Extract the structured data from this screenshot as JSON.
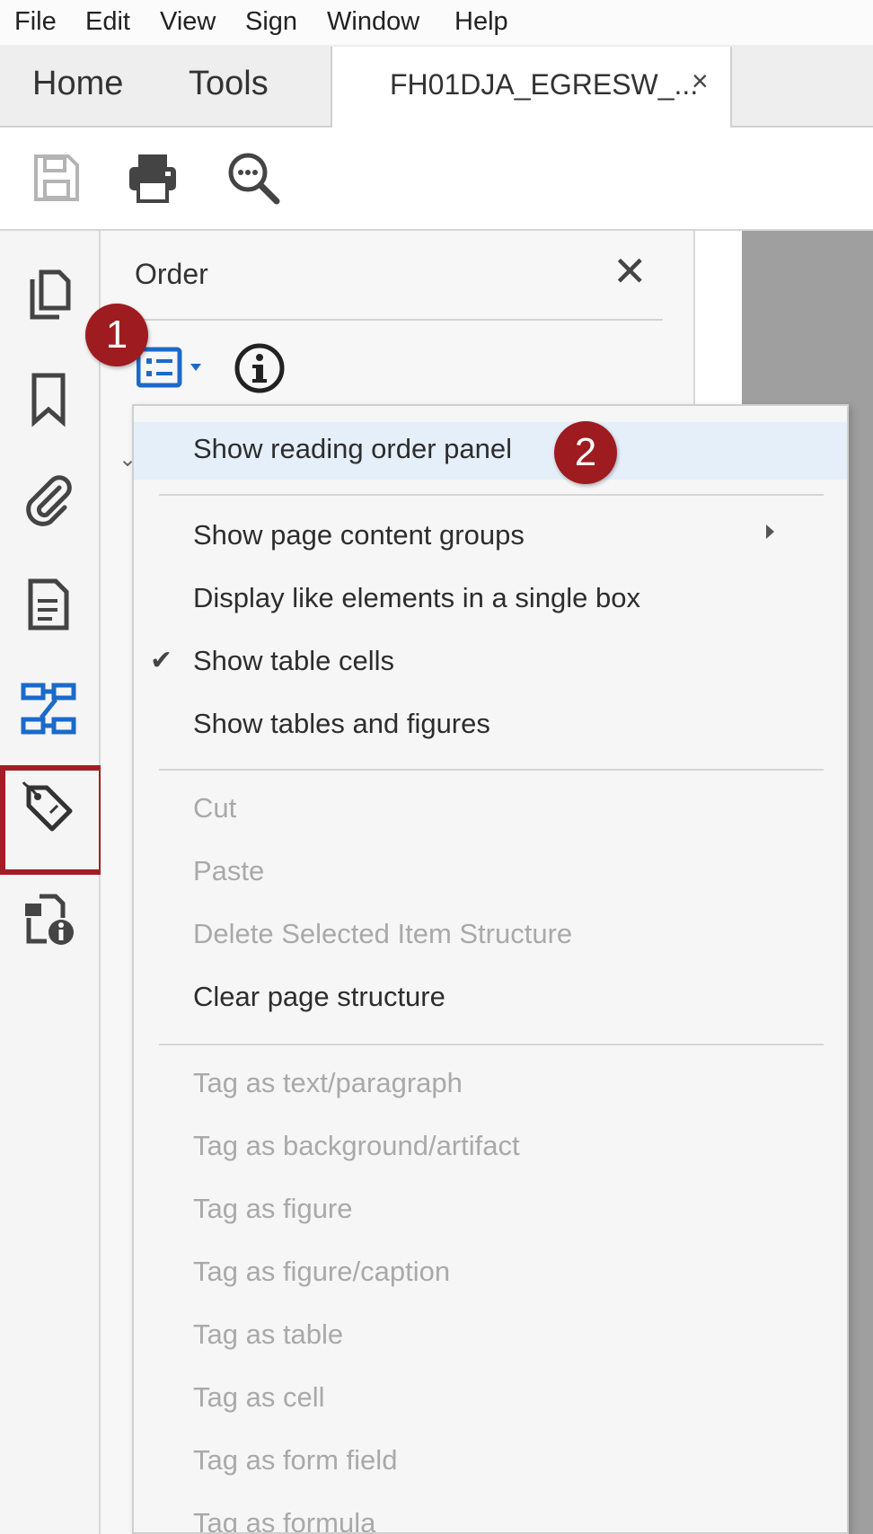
{
  "menubar": [
    "File",
    "Edit",
    "View",
    "Sign",
    "Window",
    "Help"
  ],
  "tabs": {
    "home": "Home",
    "tools": "Tools",
    "document": "FH01DJA_EGRESW_...",
    "close": "×"
  },
  "toolbar": {
    "icons": [
      "save-icon",
      "print-icon",
      "find-icon"
    ]
  },
  "left_rail": {
    "icons": [
      "pages-icon",
      "bookmark-icon",
      "attachment-icon",
      "page-properties-icon",
      "reading-order-icon",
      "tags-icon",
      "content-info-icon"
    ],
    "highlighted": "tags-icon"
  },
  "panel": {
    "title": "Order",
    "close": "✕"
  },
  "badges": {
    "one": "1",
    "two": "2"
  },
  "menu": {
    "items": [
      {
        "label": "Show reading order panel",
        "enabled": true,
        "selected": true
      },
      {
        "label": "Show page content groups",
        "enabled": true,
        "submenu": true
      },
      {
        "label": "Display like elements in a single box",
        "enabled": true
      },
      {
        "label": "Show table cells",
        "enabled": true,
        "checked": true
      },
      {
        "label": "Show tables and figures",
        "enabled": true
      },
      {
        "label": "Cut",
        "enabled": false
      },
      {
        "label": "Paste",
        "enabled": false
      },
      {
        "label": "Delete Selected Item Structure",
        "enabled": false
      },
      {
        "label": "Clear page structure",
        "enabled": true
      },
      {
        "label": "Tag as text/paragraph",
        "enabled": false
      },
      {
        "label": "Tag as background/artifact",
        "enabled": false
      },
      {
        "label": "Tag as figure",
        "enabled": false
      },
      {
        "label": "Tag as figure/caption",
        "enabled": false
      },
      {
        "label": "Tag as table",
        "enabled": false
      },
      {
        "label": "Tag as cell",
        "enabled": false
      },
      {
        "label": "Tag as form field",
        "enabled": false
      },
      {
        "label": "Tag as formula",
        "enabled": false
      }
    ],
    "checkmark": "✔"
  },
  "colors": {
    "badge": "#9e1b1f",
    "highlight_box": "#a51d24",
    "accent_blue": "#1b6ac9"
  }
}
